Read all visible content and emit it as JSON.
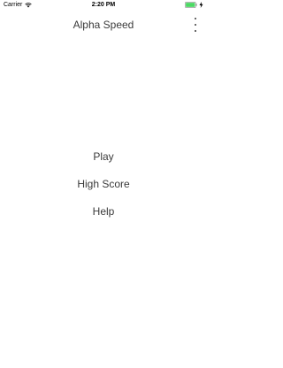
{
  "status_bar": {
    "carrier": "Carrier",
    "time": "2:20 PM",
    "wifi_icon": "wifi-icon",
    "battery_icon": "battery-icon",
    "charging_icon": "bolt-icon",
    "battery_color": "#4cd964",
    "battery_level": 1.0
  },
  "nav": {
    "title": "Alpha Speed",
    "more_icon": "more-vertical-icon"
  },
  "menu": {
    "items": [
      {
        "label": "Play"
      },
      {
        "label": "High Score"
      },
      {
        "label": "Help"
      }
    ]
  }
}
